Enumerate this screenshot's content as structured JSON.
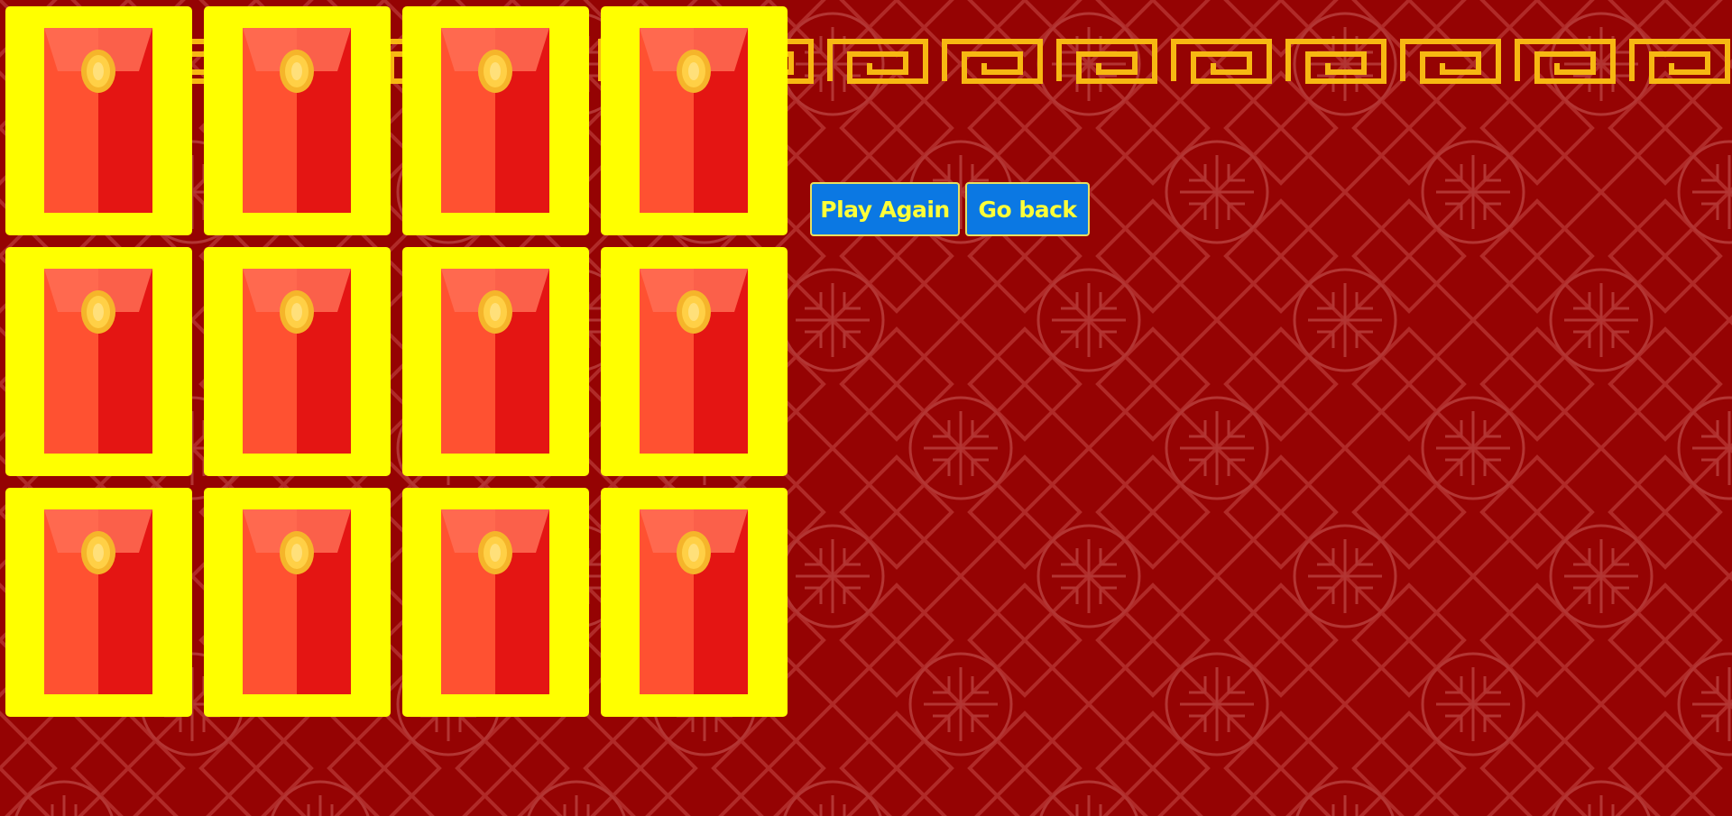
{
  "game": {
    "card_count": 12,
    "cards": [
      {
        "state": "face-down"
      },
      {
        "state": "face-down"
      },
      {
        "state": "face-down"
      },
      {
        "state": "face-down"
      },
      {
        "state": "face-down"
      },
      {
        "state": "face-down"
      },
      {
        "state": "face-down"
      },
      {
        "state": "face-down"
      },
      {
        "state": "face-down"
      },
      {
        "state": "face-down"
      },
      {
        "state": "face-down"
      },
      {
        "state": "face-down"
      }
    ],
    "card_back_icon": "red-envelope-icon"
  },
  "controls": {
    "play_again_label": "Play Again",
    "go_back_label": "Go back"
  },
  "colors": {
    "background": "#950303",
    "card_frame": "#ffff00",
    "envelope_left": "#ff5131",
    "envelope_right": "#e41513",
    "envelope_flap": "#ff6d55",
    "coin": "#ffd046",
    "button_bg": "#0b78e3",
    "button_text": "#ffff38",
    "border_gold": "#f7b812"
  }
}
